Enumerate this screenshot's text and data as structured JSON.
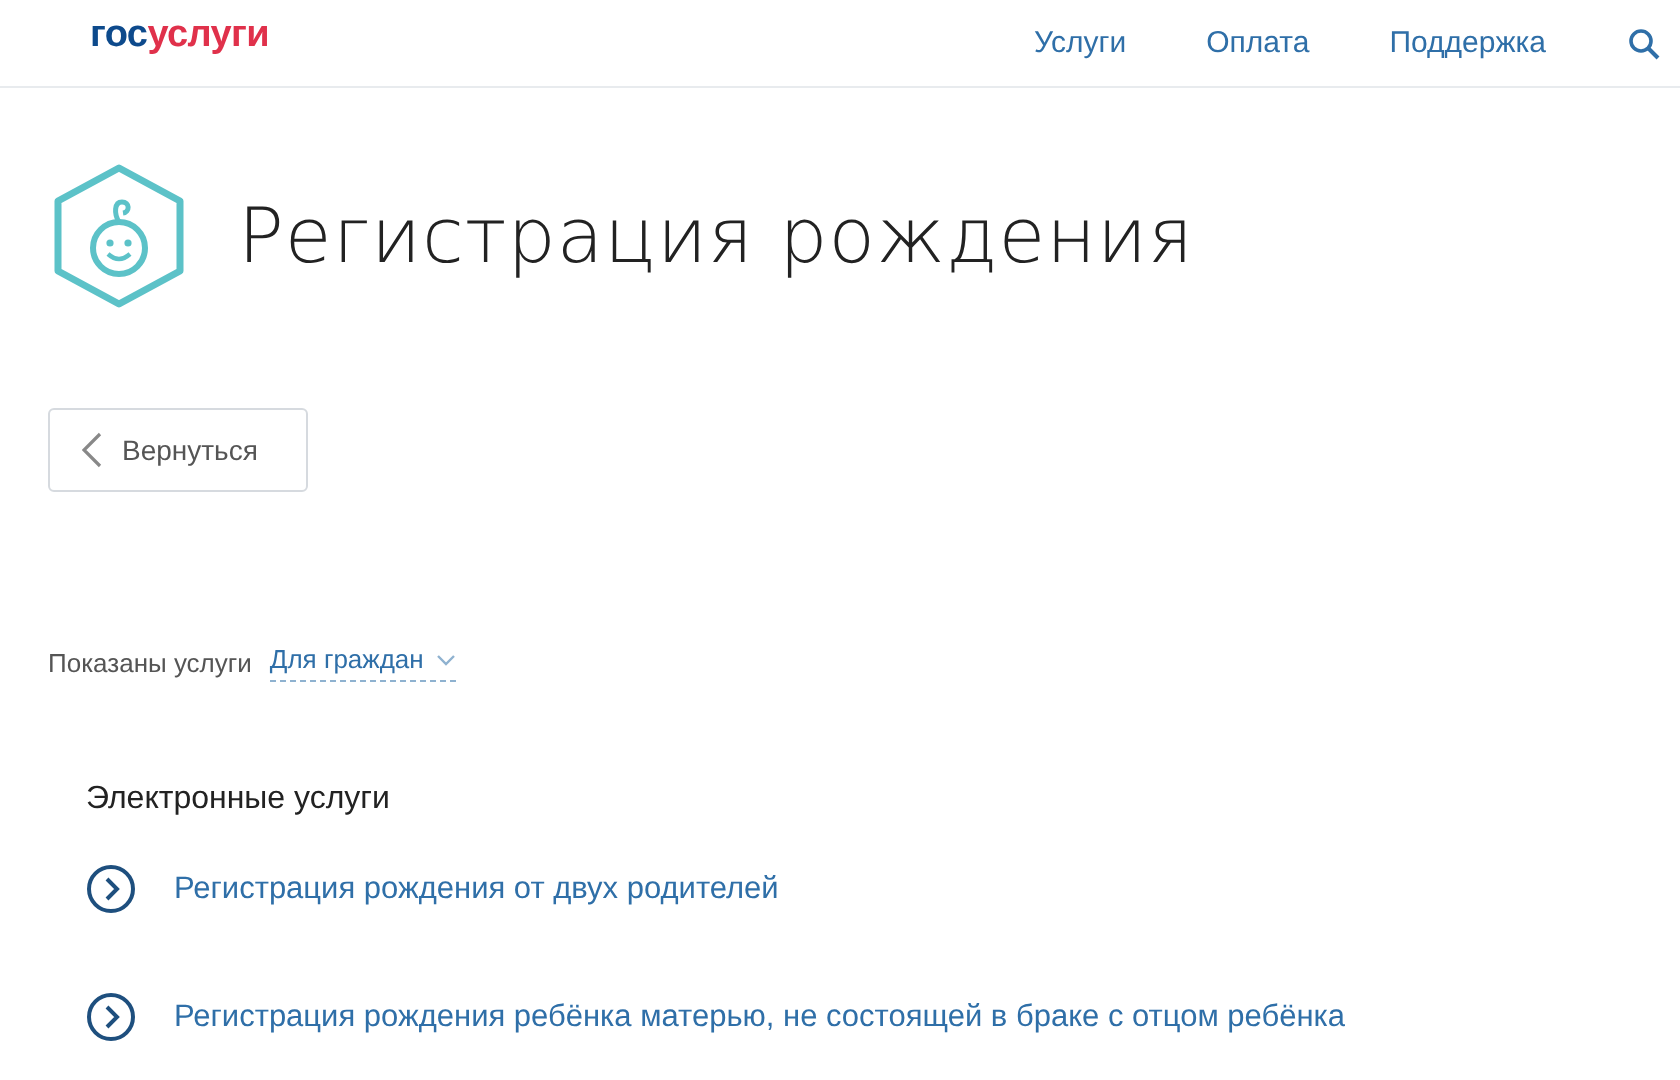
{
  "header": {
    "logo": {
      "part_1": "гос",
      "part_2": "услуги"
    },
    "nav": [
      "Услуги",
      "Оплата",
      "Поддержка"
    ]
  },
  "page_title": "Регистрация рождения",
  "back_button": "Вернуться",
  "filter": {
    "label": "Показаны услуги",
    "value": "Для граждан"
  },
  "section": {
    "title": "Электронные услуги",
    "links": [
      "Регистрация рождения от двух родителей",
      "Регистрация рождения ребёнка матерью, не состоящей в браке с отцом ребёнка"
    ]
  }
}
